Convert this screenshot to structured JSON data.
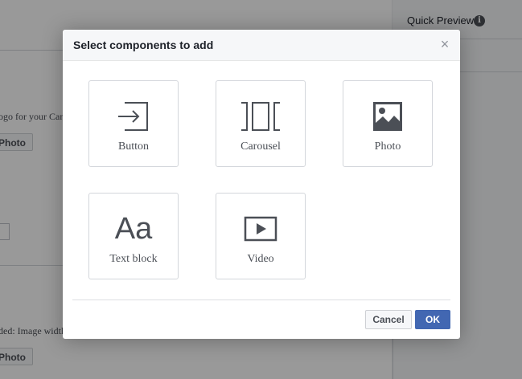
{
  "background": {
    "quick_preview_title": "Quick Preview",
    "info_icon": "info-icon",
    "logo_hint_text": "ogo for your Can",
    "photo_button_1": "Photo",
    "image_hint_text": "ded: Image width",
    "photo_button_2": "Photo"
  },
  "modal": {
    "title": "Select components to add",
    "close_icon": "close-icon",
    "components": [
      {
        "label": "Button",
        "icon": "enter-arrow-icon"
      },
      {
        "label": "Carousel",
        "icon": "carousel-icon"
      },
      {
        "label": "Photo",
        "icon": "photo-icon"
      },
      {
        "label": "Text block",
        "icon": "text-block-icon",
        "glyph": "Aa"
      },
      {
        "label": "Video",
        "icon": "video-play-icon"
      }
    ],
    "cancel_label": "Cancel",
    "ok_label": "OK"
  },
  "colors": {
    "primary_button": "#4267b2",
    "icon_color": "#4b4f56",
    "overlay": "rgba(0,0,0,0.4)"
  }
}
